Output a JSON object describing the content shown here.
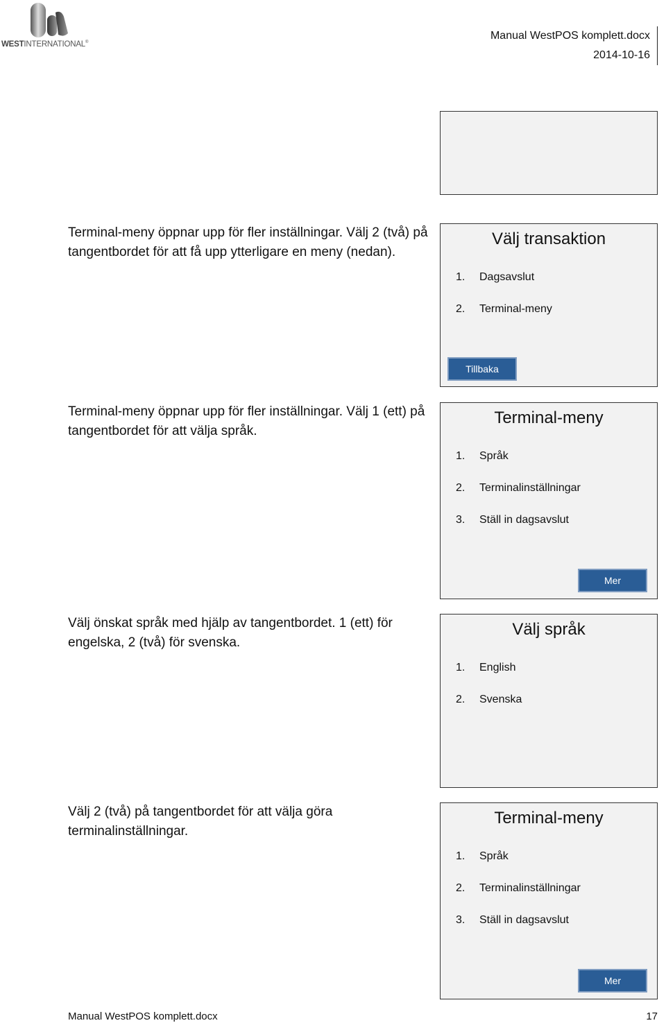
{
  "header": {
    "logo_bold": "WEST",
    "logo_rest": "INTERNATIONAL",
    "logo_mark": "®",
    "doc_name": "Manual WestPOS komplett.docx",
    "date": "2014-10-16"
  },
  "steps": [
    {
      "description": "Terminal-meny öppnar upp för fler inställningar. Välj 2 (två) på tangentbordet för att få upp ytterligare en meny (nedan).",
      "screen": {
        "title": "Välj transaktion",
        "items": [
          {
            "num": "1.",
            "label": "Dagsavslut"
          },
          {
            "num": "2.",
            "label": "Terminal-meny"
          }
        ],
        "button": "Tillbaka"
      }
    },
    {
      "description": "Terminal-meny öppnar upp för fler inställningar. Välj 1 (ett) på tangentbordet för att välja språk.",
      "screen": {
        "title": "Terminal-meny",
        "items": [
          {
            "num": "1.",
            "label": "Språk"
          },
          {
            "num": "2.",
            "label": "Terminalinställningar"
          },
          {
            "num": "3.",
            "label": "Ställ in dagsavslut"
          }
        ],
        "button": "Mer"
      }
    },
    {
      "description": "Välj önskat språk med hjälp av tangentbordet. 1 (ett) för engelska, 2 (två) för svenska.",
      "screen": {
        "title": "Välj språk",
        "items": [
          {
            "num": "1.",
            "label": "English"
          },
          {
            "num": "2.",
            "label": "Svenska"
          }
        ]
      }
    },
    {
      "description": "Välj 2 (två) på tangentbordet för att välja göra terminalinställningar.",
      "screen": {
        "title": "Terminal-meny",
        "items": [
          {
            "num": "1.",
            "label": "Språk"
          },
          {
            "num": "2.",
            "label": "Terminalinställningar"
          },
          {
            "num": "3.",
            "label": "Ställ in dagsavslut"
          }
        ],
        "button": "Mer"
      }
    }
  ],
  "footer": {
    "doc_name": "Manual WestPOS komplett.docx",
    "page_number": "17"
  },
  "colors": {
    "button_bg": "#2a5d96",
    "screen_bg": "#f2f2f2"
  }
}
